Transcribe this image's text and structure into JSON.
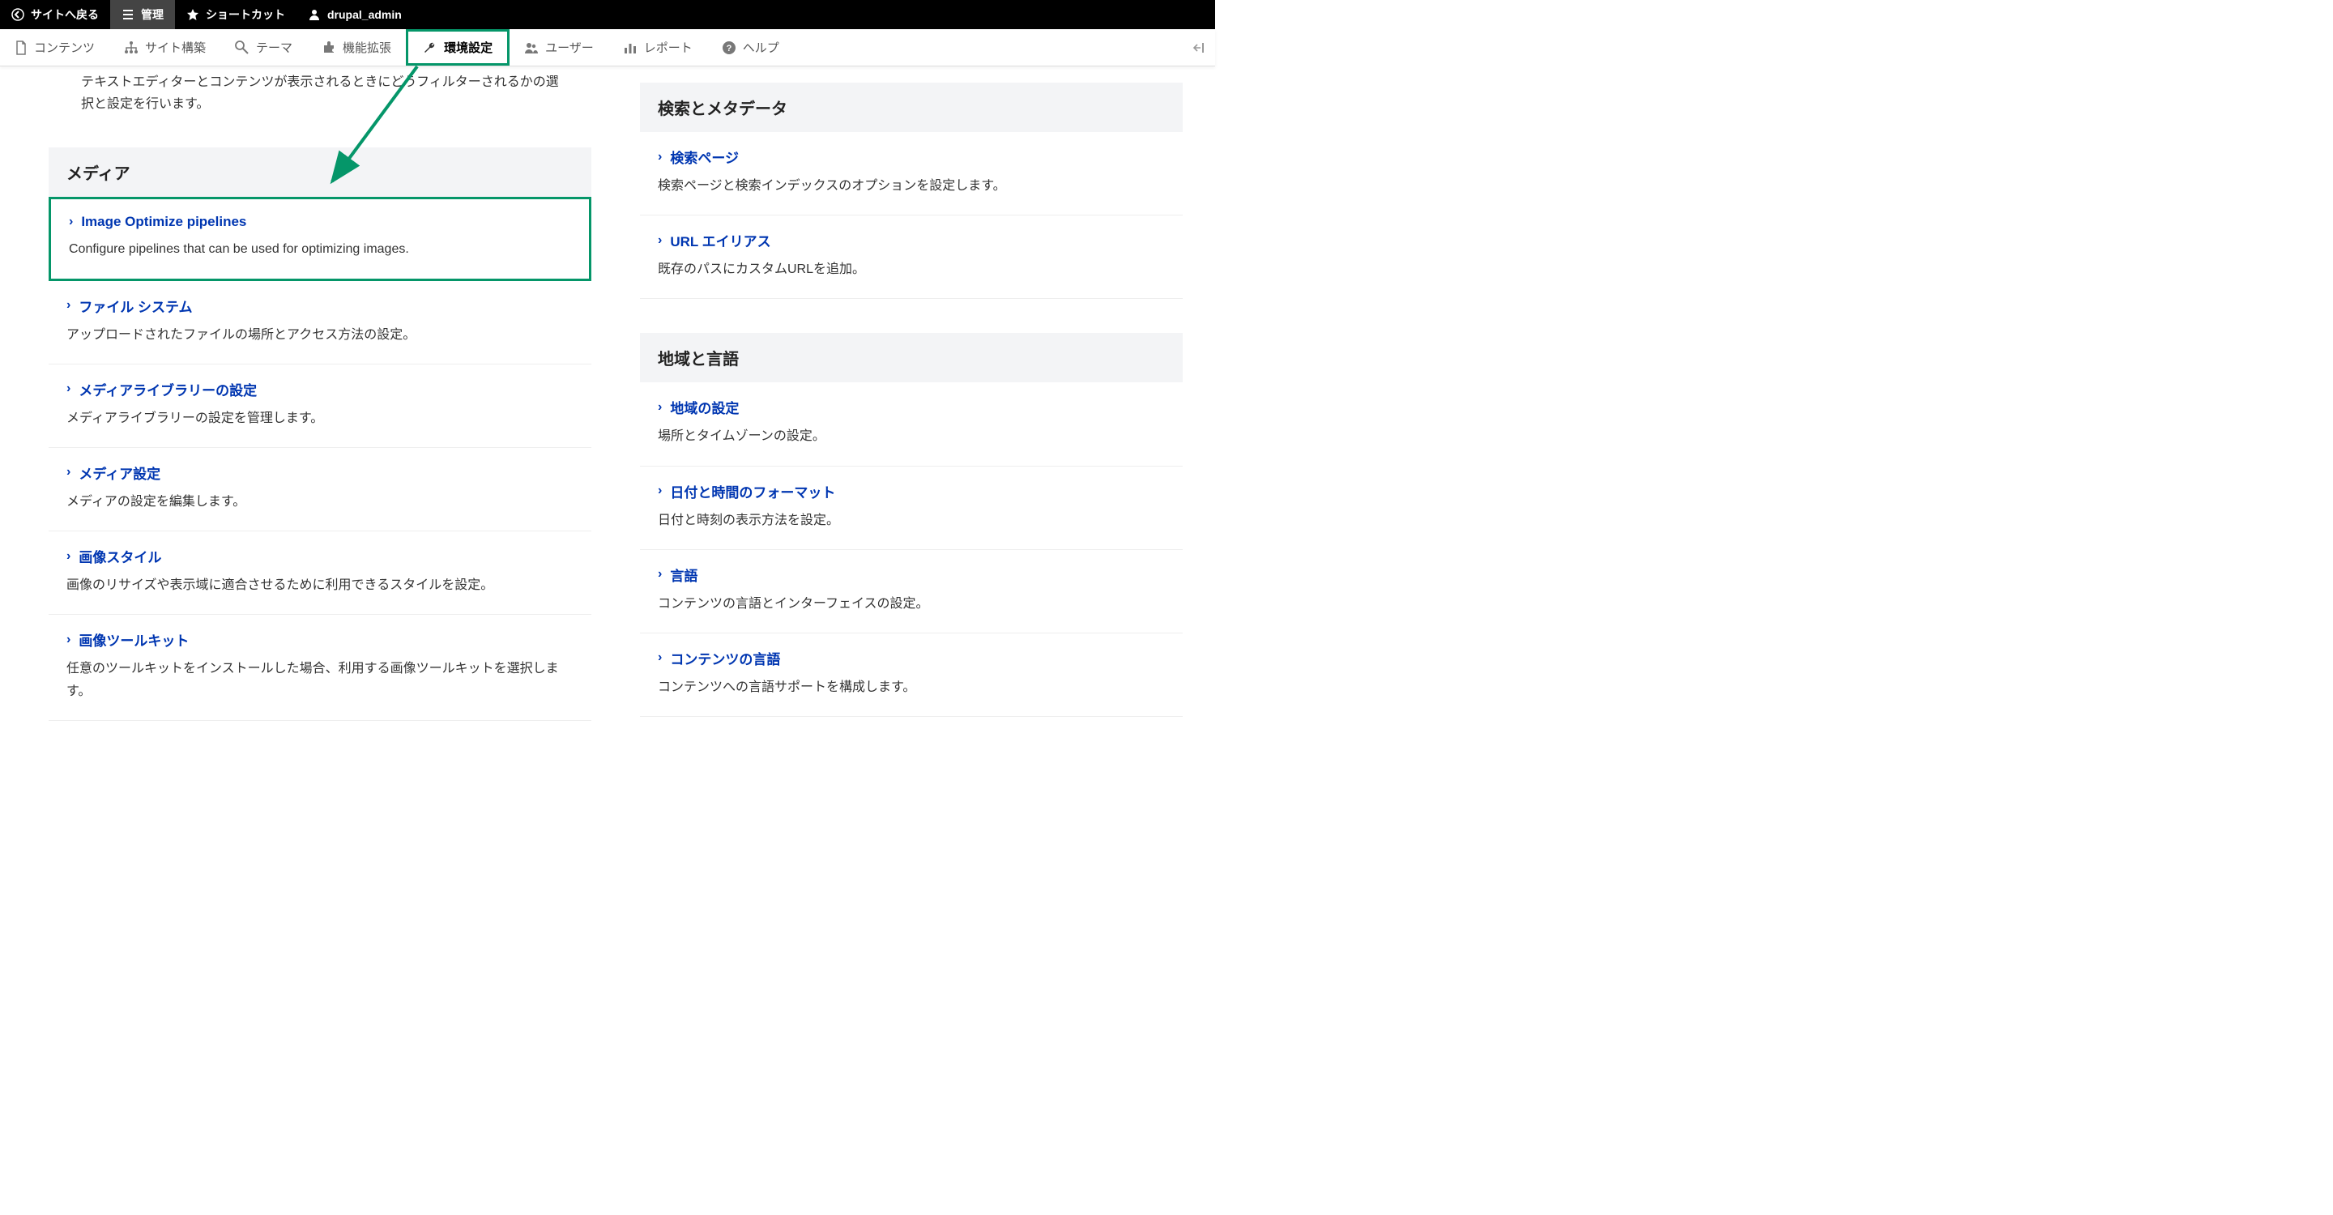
{
  "topbar": {
    "back": "サイトへ戻る",
    "manage": "管理",
    "shortcuts": "ショートカット",
    "user": "drupal_admin"
  },
  "admintabs": {
    "content": "コンテンツ",
    "structure": "サイト構築",
    "appearance": "テーマ",
    "extend": "機能拡張",
    "configuration": "環境設定",
    "people": "ユーザー",
    "reports": "レポート",
    "help": "ヘルプ"
  },
  "left": {
    "top_desc": "テキストエディターとコンテンツが表示されるときにどうフィルターされるかの選択と設定を行います。",
    "media_header": "メディア",
    "items": [
      {
        "title": "Image Optimize pipelines",
        "desc": "Configure pipelines that can be used for optimizing images."
      },
      {
        "title": "ファイル システム",
        "desc": "アップロードされたファイルの場所とアクセス方法の設定。"
      },
      {
        "title": "メディアライブラリーの設定",
        "desc": "メディアライブラリーの設定を管理します。"
      },
      {
        "title": "メディア設定",
        "desc": "メディアの設定を編集します。"
      },
      {
        "title": "画像スタイル",
        "desc": "画像のリサイズや表示域に適合させるために利用できるスタイルを設定。"
      },
      {
        "title": "画像ツールキット",
        "desc": "任意のツールキットをインストールした場合、利用する画像ツールキットを選択します。"
      }
    ]
  },
  "right": {
    "sections": [
      {
        "header": "検索とメタデータ",
        "items": [
          {
            "title": "検索ページ",
            "desc": "検索ページと検索インデックスのオプションを設定します。"
          },
          {
            "title": "URL エイリアス",
            "desc": "既存のパスにカスタムURLを追加。"
          }
        ]
      },
      {
        "header": "地域と言語",
        "items": [
          {
            "title": "地域の設定",
            "desc": "場所とタイムゾーンの設定。"
          },
          {
            "title": "日付と時間のフォーマット",
            "desc": "日付と時刻の表示方法を設定。"
          },
          {
            "title": "言語",
            "desc": "コンテンツの言語とインターフェイスの設定。"
          },
          {
            "title": "コンテンツの言語",
            "desc": "コンテンツへの言語サポートを構成します。"
          }
        ]
      }
    ]
  }
}
